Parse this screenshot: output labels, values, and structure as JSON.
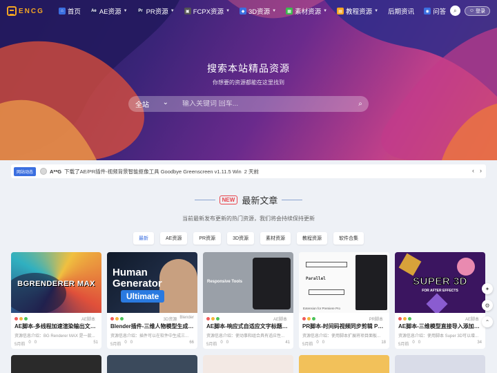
{
  "brand": {
    "logo_text": "ENCG",
    "accent": "#f5a623"
  },
  "nav": {
    "items": [
      {
        "label": "首页",
        "icon": "home-icon",
        "color": "#3b6fe0",
        "glyph": "⌂",
        "dropdown": false
      },
      {
        "label": "AE资源",
        "icon": "ae-icon",
        "color": "#1f1b5a",
        "glyph": "Ae",
        "dropdown": true
      },
      {
        "label": "PR资源",
        "icon": "pr-icon",
        "color": "#1f1b5a",
        "glyph": "Pr",
        "dropdown": true
      },
      {
        "label": "FCPX资源",
        "icon": "fcpx-icon",
        "color": "#555",
        "glyph": "▣",
        "dropdown": true
      },
      {
        "label": "3D资源",
        "icon": "cube-icon",
        "color": "#3b6fe0",
        "glyph": "◆",
        "dropdown": true
      },
      {
        "label": "素材资源",
        "icon": "material-icon",
        "color": "#3fb950",
        "glyph": "▦",
        "dropdown": true
      },
      {
        "label": "教程资源",
        "icon": "tutorial-icon",
        "color": "#f5a623",
        "glyph": "▤",
        "dropdown": true
      },
      {
        "label": "后期资讯",
        "icon": "",
        "color": "",
        "glyph": "",
        "dropdown": false
      },
      {
        "label": "问答",
        "icon": "qa-icon",
        "color": "#3b6fe0",
        "glyph": "◉",
        "dropdown": false
      }
    ],
    "login_label": "登录"
  },
  "hero": {
    "title": "搜索本站精品资源",
    "subtitle": "你想要的资源都能在这里找到",
    "scope": "全站",
    "placeholder": "输入关键词 回车..."
  },
  "ticker": {
    "badge": "网站动态",
    "user": "A**G",
    "text": "下载了AE/PR插件-视频背景智能抠像工具 Goodbye Greenscreen v1.11.5 Win",
    "time": "2 天前"
  },
  "section": {
    "badge": "NEW",
    "title": "最新文章",
    "subtitle": "当前最新发布更新的热门资源，我们将会持续保持更新",
    "tabs": [
      "最新",
      "AE资源",
      "PR资源",
      "3D资源",
      "素材资源",
      "教程资源",
      "软件合集"
    ]
  },
  "cards": [
    {
      "title": "AE脚本-多线程加速渲染输出文件 ...",
      "cat": "AE脚本",
      "cat2": "",
      "desc": "资源信息介绍：BG Renderer MAX 是一款...",
      "time": "5月前",
      "likes": "0",
      "comments": "0",
      "views": "51",
      "thumb_text": "BGRENDERER MAX"
    },
    {
      "title": "Blender插件-三维人物模型生成器...",
      "cat": "3D资源",
      "cat2": "Blender",
      "desc": "资源信息介绍：插件可以在软件中生成三...",
      "time": "5月前",
      "likes": "0",
      "comments": "0",
      "views": "66",
      "thumb_text": "Human Generator",
      "thumb_text2": "Ultimate"
    },
    {
      "title": "AE脚本-响应式自适应文字标题布...",
      "cat": "AE脚本",
      "cat2": "",
      "desc": "资源信息介绍：使动事和组合具有适应性...",
      "time": "5月前",
      "likes": "0",
      "comments": "0",
      "views": "41",
      "thumb_text": "Responsive Tools"
    },
    {
      "title": "PR脚本-时间码视频同步剪辑 Par...",
      "cat": "PR脚本",
      "cat2": "",
      "desc": "资源信息介绍：使用脚本扩展将项目面板...",
      "time": "5月前",
      "likes": "0",
      "comments": "0",
      "views": "18",
      "thumb_text": "Parallel",
      "thumb_text2": "Extension for Premiere Pro"
    },
    {
      "title": "AE脚本-三维模型直接导入添加纹...",
      "cat": "AE脚本",
      "cat2": "",
      "desc": "资源信息介绍：使用脚本 Super 3D可以增...",
      "time": "5月前",
      "likes": "0",
      "comments": "0",
      "views": "34",
      "thumb_text": "SUPER 3D",
      "thumb_text2": "FOR AFTER EFFECTS"
    }
  ]
}
